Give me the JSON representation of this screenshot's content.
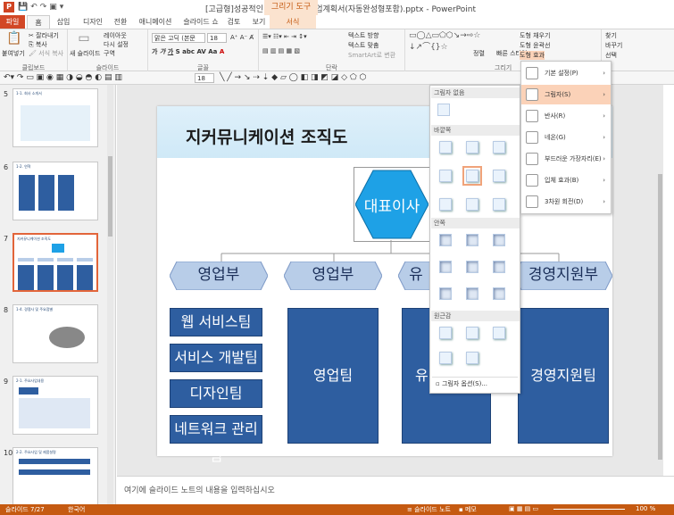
{
  "window": {
    "app_icon": "P",
    "title": "[고급형]성공적인 발표를 위한 사업계획서(자동완성형포함).pptx - PowerPoint",
    "context_tab": "그리기 도구"
  },
  "tabs": [
    "파일",
    "홈",
    "삽입",
    "디자인",
    "전환",
    "애니메이션",
    "슬라이드 쇼",
    "검토",
    "보기",
    "서식"
  ],
  "ribbon": {
    "clipboard": {
      "label": "클립보드",
      "paste": "붙여넣기",
      "cut": "잘라내기",
      "copy": "복사",
      "format_painter": "서식 복사"
    },
    "slides": {
      "label": "슬라이드",
      "new_slide": "새 슬라이드",
      "layout": "레이아웃",
      "reset": "다시 설정",
      "section": "구역"
    },
    "font": {
      "label": "글꼴",
      "font_name": "맑은 고딕 (본문",
      "font_size": "18"
    },
    "paragraph": {
      "label": "단락",
      "text_direction": "텍스트 방향",
      "align_text": "텍스트 맞춤",
      "smartart": "SmartArt로 변환"
    },
    "drawing": {
      "label": "그리기",
      "arrange": "정렬",
      "quick_styles": "빠른 스타일",
      "shape_fill": "도형 채우기",
      "shape_outline": "도형 윤곽선",
      "shape_effects": "도형 효과"
    },
    "editing": {
      "find": "찾기",
      "replace": "바꾸기",
      "select": "선택"
    }
  },
  "toolbar2": {
    "font_size": "18"
  },
  "thumbnails": [
    {
      "num": "5",
      "title": "1-1. 회사 소개서"
    },
    {
      "num": "6",
      "title": "1-2. 연혁"
    },
    {
      "num": "7",
      "title": "지커뮤니케이션 조직도",
      "selected": true
    },
    {
      "num": "8",
      "title": "1-4. 경쟁사 및 주요점별"
    },
    {
      "num": "9",
      "title": "2-1. 주요사업내용"
    },
    {
      "num": "10",
      "title": "2-2. 주요사업 및 제품설명"
    }
  ],
  "slide": {
    "title": "지커뮤니케이션 조직도",
    "ceo": "대표이사",
    "departments": [
      "영업부",
      "영업부",
      "유",
      "경영지원부"
    ],
    "teams_col1": [
      "웹 서비스팀",
      "서비스 개발팀",
      "디자인팀",
      "네트워크 관리팀"
    ],
    "teams": [
      "영업팀",
      "유",
      "경영지원팀"
    ]
  },
  "shadow_gallery": {
    "none": "그림자 없음",
    "outer": "바깥쪽",
    "inner": "안쪽",
    "perspective": "원근감",
    "options": "그림자 옵션(S)..."
  },
  "effects_menu": [
    {
      "label": "기본 설정(P)"
    },
    {
      "label": "그림자(S)",
      "active": true
    },
    {
      "label": "반사(R)"
    },
    {
      "label": "네온(G)"
    },
    {
      "label": "부드러운 가장자리(E)"
    },
    {
      "label": "입체 효과(B)"
    },
    {
      "label": "3차원 회전(D)"
    }
  ],
  "notes": "여기에 슬라이드 노트의 내용을 입력하십시오",
  "status": {
    "slide": "슬라이드 7/27",
    "language": "한국어",
    "notes_btn": "슬라이드 노트",
    "comments_btn": "메모",
    "zoom": "100 %"
  },
  "colors": {
    "accent": "#c55a11",
    "ceo_fill": "#1ea1e6",
    "dept_fill": "#b8cde8",
    "team_fill": "#2e5ea0"
  }
}
